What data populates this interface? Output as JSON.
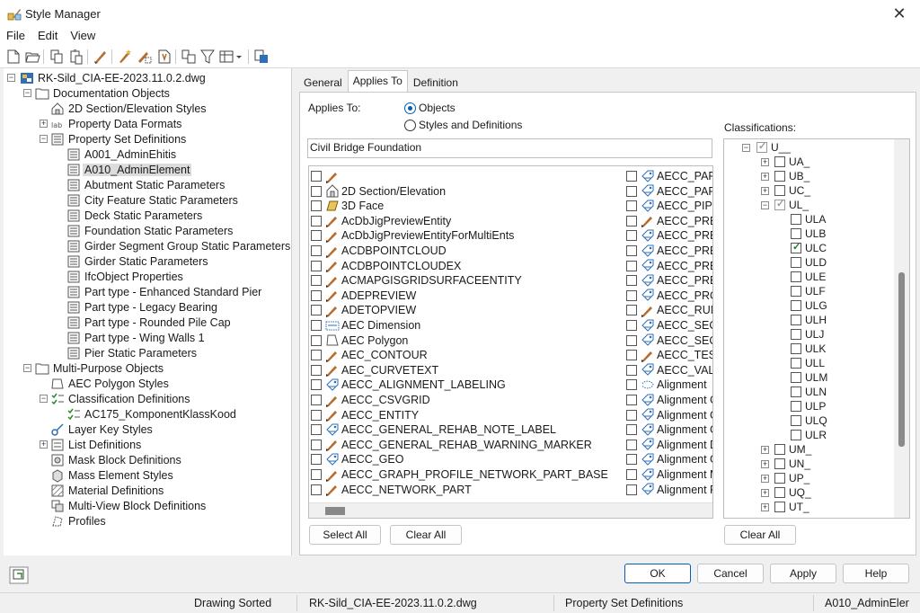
{
  "window": {
    "title": "Style Manager"
  },
  "menu": [
    "File",
    "Edit",
    "View"
  ],
  "tree": {
    "root": "RK-Sild_CIA-EE-2023.11.0.2.dwg",
    "documentation_objects": "Documentation Objects",
    "doc_children": [
      "2D Section/Elevation Styles",
      "Property Data Formats",
      "Property Set Definitions"
    ],
    "psd_children": [
      "A001_AdminEhitis",
      "A010_AdminElement",
      "Abutment Static Parameters",
      "City Feature Static Parameters",
      "Deck Static Parameters",
      "Foundation Static Parameters",
      "Girder Segment Group Static Parameters",
      "Girder Static Parameters",
      "IfcObject Properties",
      "Part type - Enhanced Standard Pier",
      "Part type - Legacy Bearing",
      "Part type - Rounded Pile Cap",
      "Part type - Wing Walls 1",
      "Pier Static Parameters"
    ],
    "multi_purpose": "Multi-Purpose Objects",
    "mp_children": [
      "AEC Polygon Styles",
      "Classification Definitions"
    ],
    "class_child": "AC175_KomponentKlassKood",
    "mp_rest": [
      "Layer Key Styles",
      "List Definitions",
      "Mask Block Definitions",
      "Mass Element Styles",
      "Material Definitions",
      "Multi-View Block Definitions",
      "Profiles"
    ]
  },
  "tabs": [
    "General",
    "Applies To",
    "Definition"
  ],
  "applies_to": {
    "label": "Applies To:",
    "option_objects": "Objects",
    "option_styles": "Styles and Definitions",
    "selected": "Objects",
    "filter_value": "Civil Bridge Foundation"
  },
  "objects_col1": [
    "",
    "2D Section/Elevation",
    "3D Face",
    "AcDbJigPreviewEntity",
    "AcDbJigPreviewEntityForMultiEnts",
    "ACDBPOINTCLOUD",
    "ACDBPOINTCLOUDEX",
    "ACMAPGISGRIDSURFACEENTITY",
    "ADEPREVIEW",
    "ADETOPVIEW",
    "AEC Dimension",
    "AEC Polygon",
    "AEC_CONTOUR",
    "AEC_CURVETEXT",
    "AECC_ALIGNMENT_LABELING",
    "AECC_CSVGRID",
    "AECC_ENTITY",
    "AECC_GENERAL_REHAB_NOTE_LABEL",
    "AECC_GENERAL_REHAB_WARNING_MARKER",
    "AECC_GEO",
    "AECC_GRAPH_PROFILE_NETWORK_PART_BASE",
    "AECC_NETWORK_PART"
  ],
  "objects_col2": [
    "AECC_PART_",
    "AECC_PART_",
    "AECC_PIPE_F",
    "AECC_PRESS",
    "AECC_PRESS",
    "AECC_PRESS",
    "AECC_PRESS",
    "AECC_PRESS",
    "AECC_PROFI",
    "AECC_RUNT",
    "AECC_SECTIO",
    "AECC_SECTIO",
    "AECC_TESSE",
    "AECC_VALIG",
    "Alignment",
    "Alignment C",
    "Alignment C",
    "Alignment C",
    "Alignment D",
    "Alignment G",
    "Alignment M",
    "Alignment P"
  ],
  "classifications": {
    "label": "Classifications:",
    "items": [
      {
        "label": "U__",
        "level": 0,
        "expander": "-",
        "checked": true,
        "grey": true
      },
      {
        "label": "UA_",
        "level": 1,
        "expander": "+",
        "checked": false
      },
      {
        "label": "UB_",
        "level": 1,
        "expander": "+",
        "checked": false
      },
      {
        "label": "UC_",
        "level": 1,
        "expander": "+",
        "checked": false
      },
      {
        "label": "UL_",
        "level": 1,
        "expander": "-",
        "checked": true,
        "grey": true
      },
      {
        "label": "ULA",
        "level": 2,
        "checked": false
      },
      {
        "label": "ULB",
        "level": 2,
        "checked": false
      },
      {
        "label": "ULC",
        "level": 2,
        "checked": true
      },
      {
        "label": "ULD",
        "level": 2,
        "checked": false
      },
      {
        "label": "ULE",
        "level": 2,
        "checked": false
      },
      {
        "label": "ULF",
        "level": 2,
        "checked": false
      },
      {
        "label": "ULG",
        "level": 2,
        "checked": false
      },
      {
        "label": "ULH",
        "level": 2,
        "checked": false
      },
      {
        "label": "ULJ",
        "level": 2,
        "checked": false
      },
      {
        "label": "ULK",
        "level": 2,
        "checked": false
      },
      {
        "label": "ULL",
        "level": 2,
        "checked": false
      },
      {
        "label": "ULM",
        "level": 2,
        "checked": false
      },
      {
        "label": "ULN",
        "level": 2,
        "checked": false
      },
      {
        "label": "ULP",
        "level": 2,
        "checked": false
      },
      {
        "label": "ULQ",
        "level": 2,
        "checked": false
      },
      {
        "label": "ULR",
        "level": 2,
        "checked": false
      },
      {
        "label": "UM_",
        "level": 1,
        "expander": "+",
        "checked": false
      },
      {
        "label": "UN_",
        "level": 1,
        "expander": "+",
        "checked": false
      },
      {
        "label": "UP_",
        "level": 1,
        "expander": "+",
        "checked": false
      },
      {
        "label": "UQ_",
        "level": 1,
        "expander": "+",
        "checked": false
      },
      {
        "label": "UT_",
        "level": 1,
        "expander": "+",
        "checked": false
      }
    ]
  },
  "buttons": {
    "select_all": "Select All",
    "clear_all": "Clear All",
    "clear_all_class": "Clear All",
    "ok": "OK",
    "cancel": "Cancel",
    "apply": "Apply",
    "help": "Help"
  },
  "status": {
    "sort": "Drawing Sorted",
    "drawing": "RK-Sild_CIA-EE-2023.11.0.2.dwg",
    "category": "Property Set Definitions",
    "item": "A010_AdminEler"
  },
  "colors": {
    "accent": "#005fb8",
    "folder": "#e8b84a",
    "brush": "#b86b2b"
  }
}
